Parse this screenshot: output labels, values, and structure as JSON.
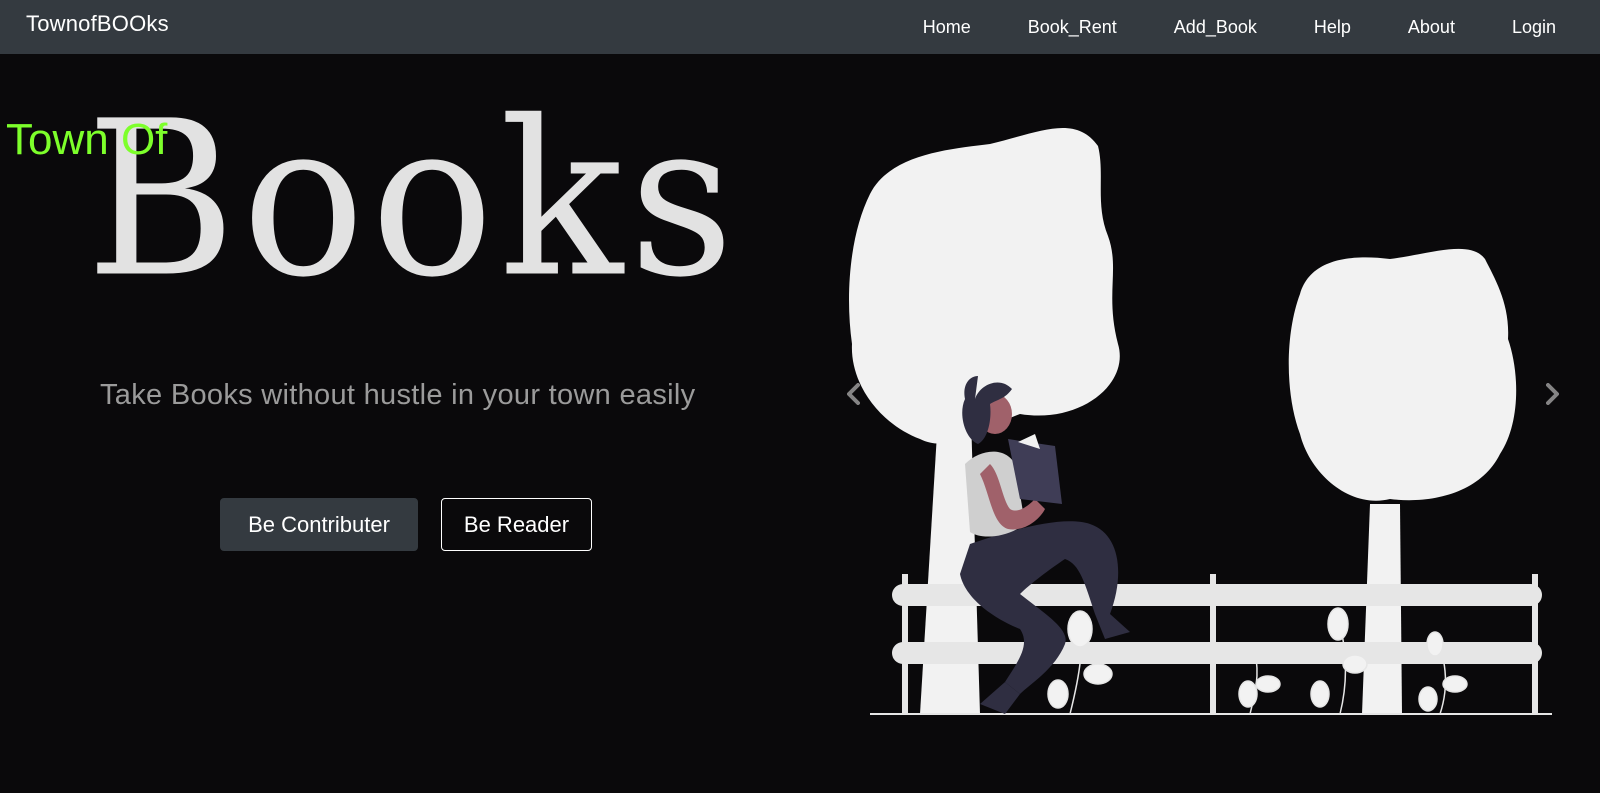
{
  "navbar": {
    "brand": "TownofBOOks",
    "links": [
      "Home",
      "Book_Rent",
      "Add_Book",
      "Help",
      "About",
      "Login"
    ]
  },
  "hero": {
    "title_small": "Town Of",
    "title_large": "Books",
    "tagline": "Take Books without hustle in your town easily",
    "buttons": {
      "contributor": "Be Contributer",
      "reader": "Be Reader"
    }
  },
  "carousel": {
    "prev_icon": "chevron-left-icon",
    "next_icon": "chevron-right-icon",
    "illustration": "woman-reading-on-fence-illustration"
  },
  "colors": {
    "background": "#0a090b",
    "navbar": "#343a40",
    "accent_green": "#7dff2b",
    "title_text": "#e2e2e2",
    "tagline_text": "#9b9b9b",
    "illustration_fill": "#f2f2f2",
    "figure_dark": "#2f2e41"
  }
}
